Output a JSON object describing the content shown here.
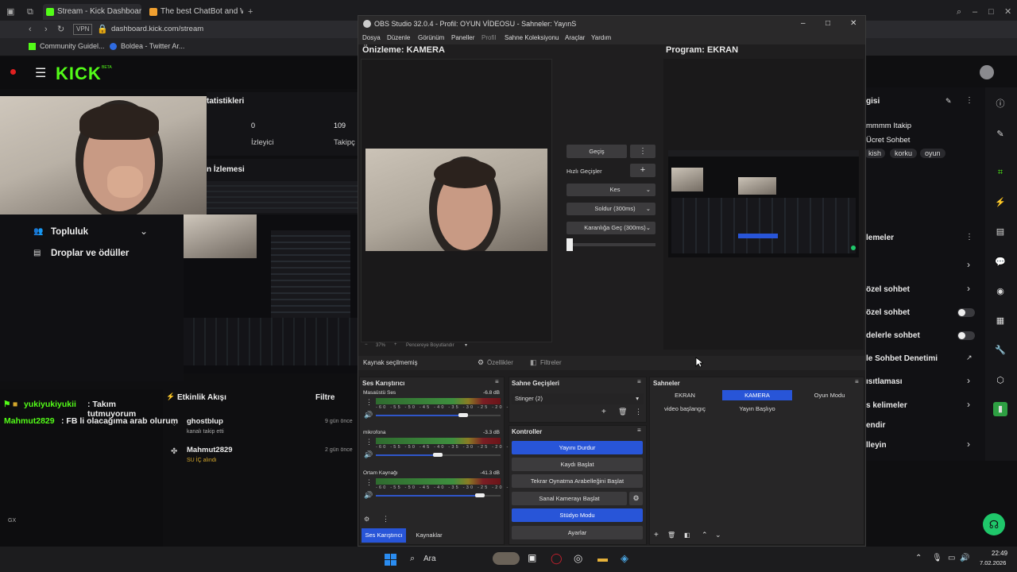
{
  "browser": {
    "tabs": [
      {
        "label": "Stream - Kick Dashboard",
        "active": true,
        "color": "#53fc18"
      },
      {
        "label": "The best ChatBot and Wid",
        "active": false,
        "color": "#f0a030"
      }
    ],
    "vpn_label": "VPN",
    "url": "dashboard.kick.com/stream",
    "bookmarks": [
      "Community Guidel...",
      "Boldea - Twitter Ar..."
    ]
  },
  "kick": {
    "logo": "KICK",
    "logo_badge": "BETA",
    "stats_title": "tatistikleri",
    "stat1_value": "0",
    "stat1_label": "İzleyici",
    "stat2_value": "109",
    "stat2_label": "Takipç",
    "preview_title": "n İzlemesi",
    "nav_community": "Topluluk",
    "nav_drops": "Droplar ve ödüller",
    "activity_title": "Etkinlik Akışı",
    "activity_filter": "Filtre",
    "activity": [
      {
        "name": "ghostblup",
        "desc": "kanalı takip etti",
        "time": "9 gün önce"
      },
      {
        "name": "Mahmut2829",
        "desc": "SU İÇ alındı",
        "time": "2 gün önce"
      }
    ],
    "chat": [
      {
        "user": "yukiyukiyukii",
        "text": ": Takım tutmuyorum",
        "color": "#53fc18"
      },
      {
        "user": "Mahmut2829",
        "text": ": FB li olacağıma arab olurum",
        "color": "#53fc18"
      }
    ],
    "chat_footer": "GX",
    "right_sidebar": {
      "title": "gisi",
      "chat_lines": [
        "mmmm Itakip",
        "Ücret Sohbet"
      ],
      "tags": [
        "kish",
        "korku",
        "oyun"
      ],
      "settings_title": "lemeler",
      "items": [
        {
          "label": "özel sohbet",
          "control": "chevron"
        },
        {
          "label": "özel sohbet",
          "control": "toggle"
        },
        {
          "label": "delerle sohbet",
          "control": "toggle"
        },
        {
          "label": "le Sohbet Denetimi",
          "control": "external"
        },
        {
          "label": "ısıtlaması",
          "control": "chevron"
        },
        {
          "label": "s kelimeler",
          "control": "chevron"
        },
        {
          "label": "endir",
          "control": "none"
        },
        {
          "label": "lleyin",
          "control": "chevron"
        }
      ]
    }
  },
  "obs": {
    "title": "OBS Studio 32.0.4 - Profil: OYUN VİDEOSU - Sahneler: YayınS",
    "menu": [
      "Dosya",
      "Düzenle",
      "Görünüm",
      "Paneller",
      "Profil",
      "Sahne Koleksiyonu",
      "Araçlar",
      "Yardım"
    ],
    "preview_label": "Önizleme: KAMERA",
    "program_label": "Program: EKRAN",
    "zoom_text": "37%",
    "fit_text": "Pencereye Boyutlandır",
    "transitions": {
      "transition_btn": "Geçiş",
      "quick_label": "Hızlı Geçişler",
      "options": [
        "Kes",
        "Soldur (300ms)",
        "Karanlığa Geç (300ms)"
      ]
    },
    "source_bar": {
      "no_source": "Kaynak seçilmemiş",
      "properties": "Özellikler",
      "filters": "Filtreler"
    },
    "mixer": {
      "title": "Ses Karıştırıcı",
      "scale": "-60 -55 -50 -45 -40 -35 -30 -25 -20 -15 -10 -5 0",
      "channels": [
        {
          "name": "Masaüstü Ses",
          "db": "-6.8 dB",
          "level": 0.78
        },
        {
          "name": "mikrofona",
          "db": "-3.3 dB",
          "level": 0.55
        },
        {
          "name": "Ortam Kaynağı",
          "db": "-41.3 dB",
          "level": 0.93
        }
      ]
    },
    "scene_transitions": {
      "title": "Sahne Geçişleri",
      "selected": "Stinger (2)"
    },
    "controls": {
      "title": "Kontroller",
      "buttons": [
        {
          "label": "Yayını Durdur",
          "active": true
        },
        {
          "label": "Kaydı Başlat",
          "active": false
        },
        {
          "label": "Tekrar Oynatma Arabelleğini Başlat",
          "active": false
        },
        {
          "label": "Sanal Kamerayı Başlat",
          "active": false
        },
        {
          "label": "Stüdyo Modu",
          "active": true
        },
        {
          "label": "Ayarlar",
          "active": false
        }
      ]
    },
    "scenes": {
      "title": "Sahneler",
      "items": [
        {
          "label": "EKRAN",
          "active": false
        },
        {
          "label": "KAMERA",
          "active": true
        },
        {
          "label": "Oyun Modu",
          "active": false
        },
        {
          "label": "video başlangıç",
          "active": false
        },
        {
          "label": "Yayın Başlıyo",
          "active": false
        }
      ]
    },
    "bottom_tabs": [
      "Ses Karıştırıcı",
      "Kaynaklar"
    ]
  },
  "taskbar": {
    "search_label": "Ara",
    "time": "22:49",
    "date": "7.02.2026"
  }
}
